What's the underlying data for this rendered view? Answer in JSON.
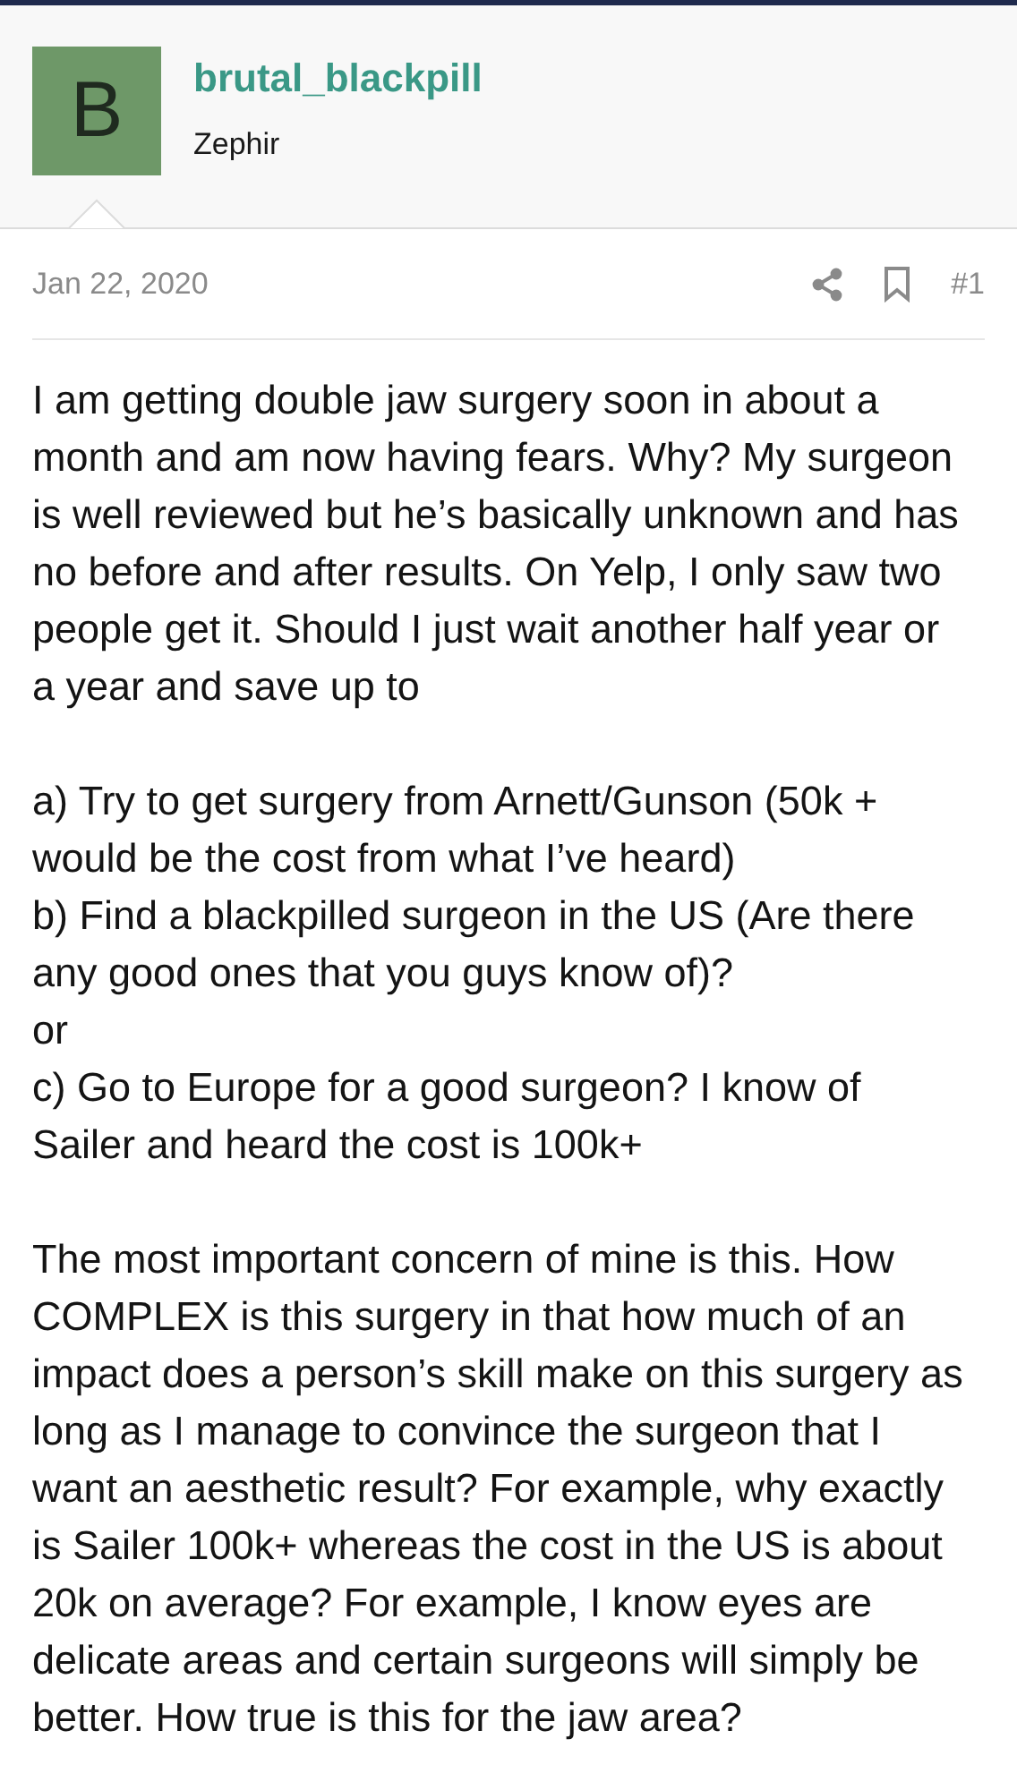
{
  "author": {
    "avatar_letter": "B",
    "name": "brutal_blackpill",
    "title": "Zephir"
  },
  "post": {
    "date": "Jan 22, 2020",
    "number": "#1",
    "paragraphs": [
      [
        "I am getting double jaw surgery soon in about a month and am now having fears. Why? My surgeon is well reviewed but he’s basically unknown and has no before and after results. On Yelp, I only saw two people get it. Should I just wait another half year or a year and save up to"
      ],
      [
        "a) Try to get surgery from Arnett/Gunson (50k + would be the cost from what I’ve heard)",
        "b) Find a blackpilled surgeon in the US (Are there any good ones that you guys know of)?",
        "or",
        "c) Go to Europe for a good surgeon? I know of Sailer and heard the cost is 100k+"
      ],
      [
        "The most important concern of mine is this. How COMPLEX is this surgery in that how much of an impact does a person’s skill make on this surgery as long as I manage to convince the surgeon that I want an aesthetic result? For example, why exactly is Sailer 100k+ whereas the cost in the US is about 20k on average? For example, I know eyes are delicate areas and certain surgeons will simply be better. How true is this for the jaw area?"
      ]
    ]
  }
}
